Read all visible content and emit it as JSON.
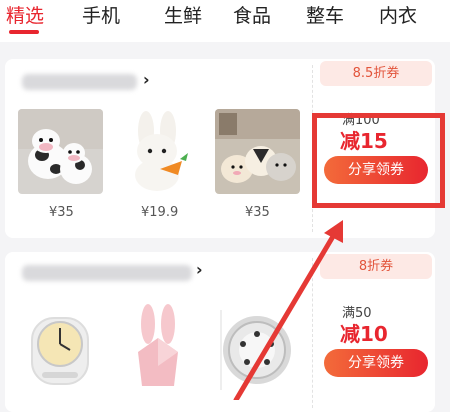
{
  "tabs": [
    {
      "label": "精选",
      "active": true
    },
    {
      "label": "手机",
      "active": false
    },
    {
      "label": "生鲜",
      "active": false
    },
    {
      "label": "食品",
      "active": false
    },
    {
      "label": "整车",
      "active": false
    },
    {
      "label": "内衣",
      "active": false
    }
  ],
  "cards": [
    {
      "arrow": "›",
      "coupon": {
        "tag": "8.5折券",
        "condition": "满100",
        "amount": "减15",
        "button": "分享领券"
      },
      "products": [
        {
          "icon": "cow-plush-toys-image",
          "price": "¥35"
        },
        {
          "icon": "bunny-plush-toy-image",
          "price": "¥19.9"
        },
        {
          "icon": "cat-plush-toys-image",
          "price": "¥35"
        }
      ]
    },
    {
      "arrow": "›",
      "coupon": {
        "tag": "8折券",
        "condition": "满50",
        "amount": "减10",
        "button": "分享领券"
      },
      "products": [
        {
          "icon": "alarm-clock-image"
        },
        {
          "icon": "bunny-lamp-image"
        },
        {
          "icon": "round-gadget-image"
        }
      ]
    }
  ],
  "colors": {
    "accent": "#e8262f",
    "annotation": "#e53935",
    "coupon_tag_bg": "#fde9e5"
  }
}
